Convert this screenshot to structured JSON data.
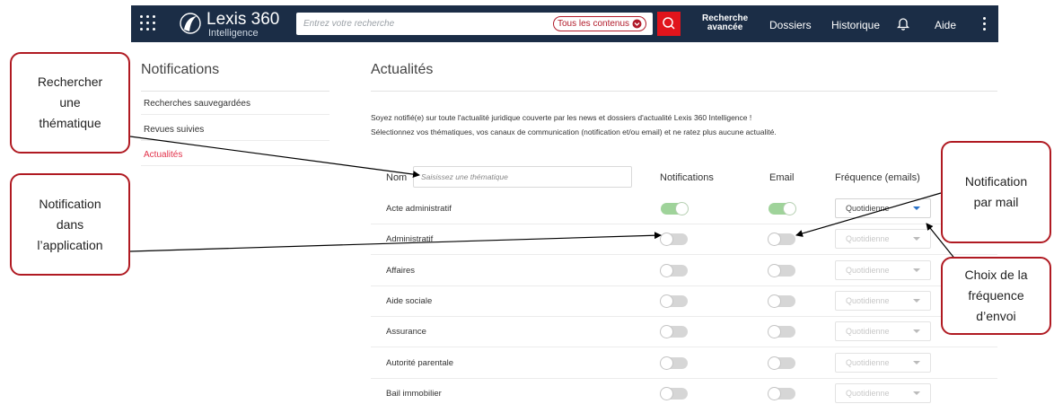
{
  "header": {
    "logo_name": "Lexis 360",
    "logo_sub": "Intelligence",
    "search_placeholder": "Entrez votre recherche",
    "content_filter": "Tous les contenus",
    "advanced_line1": "Recherche",
    "advanced_line2": "avancée",
    "nav": [
      "Dossiers",
      "Historique",
      "Aide"
    ],
    "accent": "#e1141c",
    "bar_color": "#1b2d46"
  },
  "sidebar": {
    "title": "Notifications",
    "items": [
      "Recherches sauvegardées",
      "Revues suivies",
      "Actualités"
    ],
    "active_item": "Actualités"
  },
  "main": {
    "title": "Actualités",
    "intro_line1": "Soyez notifié(e) sur toute l'actualité juridique couverte par les news et dossiers d'actualité Lexis 360 Intelligence !",
    "intro_line2": "Sélectionnez vos thématiques, vos canaux de communication (notification et/ou email) et ne ratez plus aucune actualité.",
    "columns": {
      "name": "Nom",
      "notifications": "Notifications",
      "email": "Email",
      "frequency": "Fréquence (emails)"
    },
    "theme_placeholder": "Saisissez une thématique",
    "rows": [
      {
        "label": "Acte administratif",
        "notifications": true,
        "email": true,
        "frequency": "Quotidienne"
      },
      {
        "label": "Administratif",
        "notifications": false,
        "email": false,
        "frequency": "Quotidienne"
      },
      {
        "label": "Affaires",
        "notifications": false,
        "email": false,
        "frequency": "Quotidienne"
      },
      {
        "label": "Aide sociale",
        "notifications": false,
        "email": false,
        "frequency": "Quotidienne"
      },
      {
        "label": "Assurance",
        "notifications": false,
        "email": false,
        "frequency": "Quotidienne"
      },
      {
        "label": "Autorité parentale",
        "notifications": false,
        "email": false,
        "frequency": "Quotidienne"
      },
      {
        "label": "Bail immobilier",
        "notifications": false,
        "email": false,
        "frequency": "Quotidienne"
      }
    ]
  },
  "callouts": {
    "search_theme": [
      "Rechercher",
      "une",
      "thématique"
    ],
    "in_app": [
      "Notification",
      "dans",
      "l’application"
    ],
    "by_mail": [
      "Notification",
      "par mail"
    ],
    "frequency": [
      "Choix de la",
      "fréquence",
      "d’envoi"
    ],
    "border_color": "#b01a22"
  }
}
